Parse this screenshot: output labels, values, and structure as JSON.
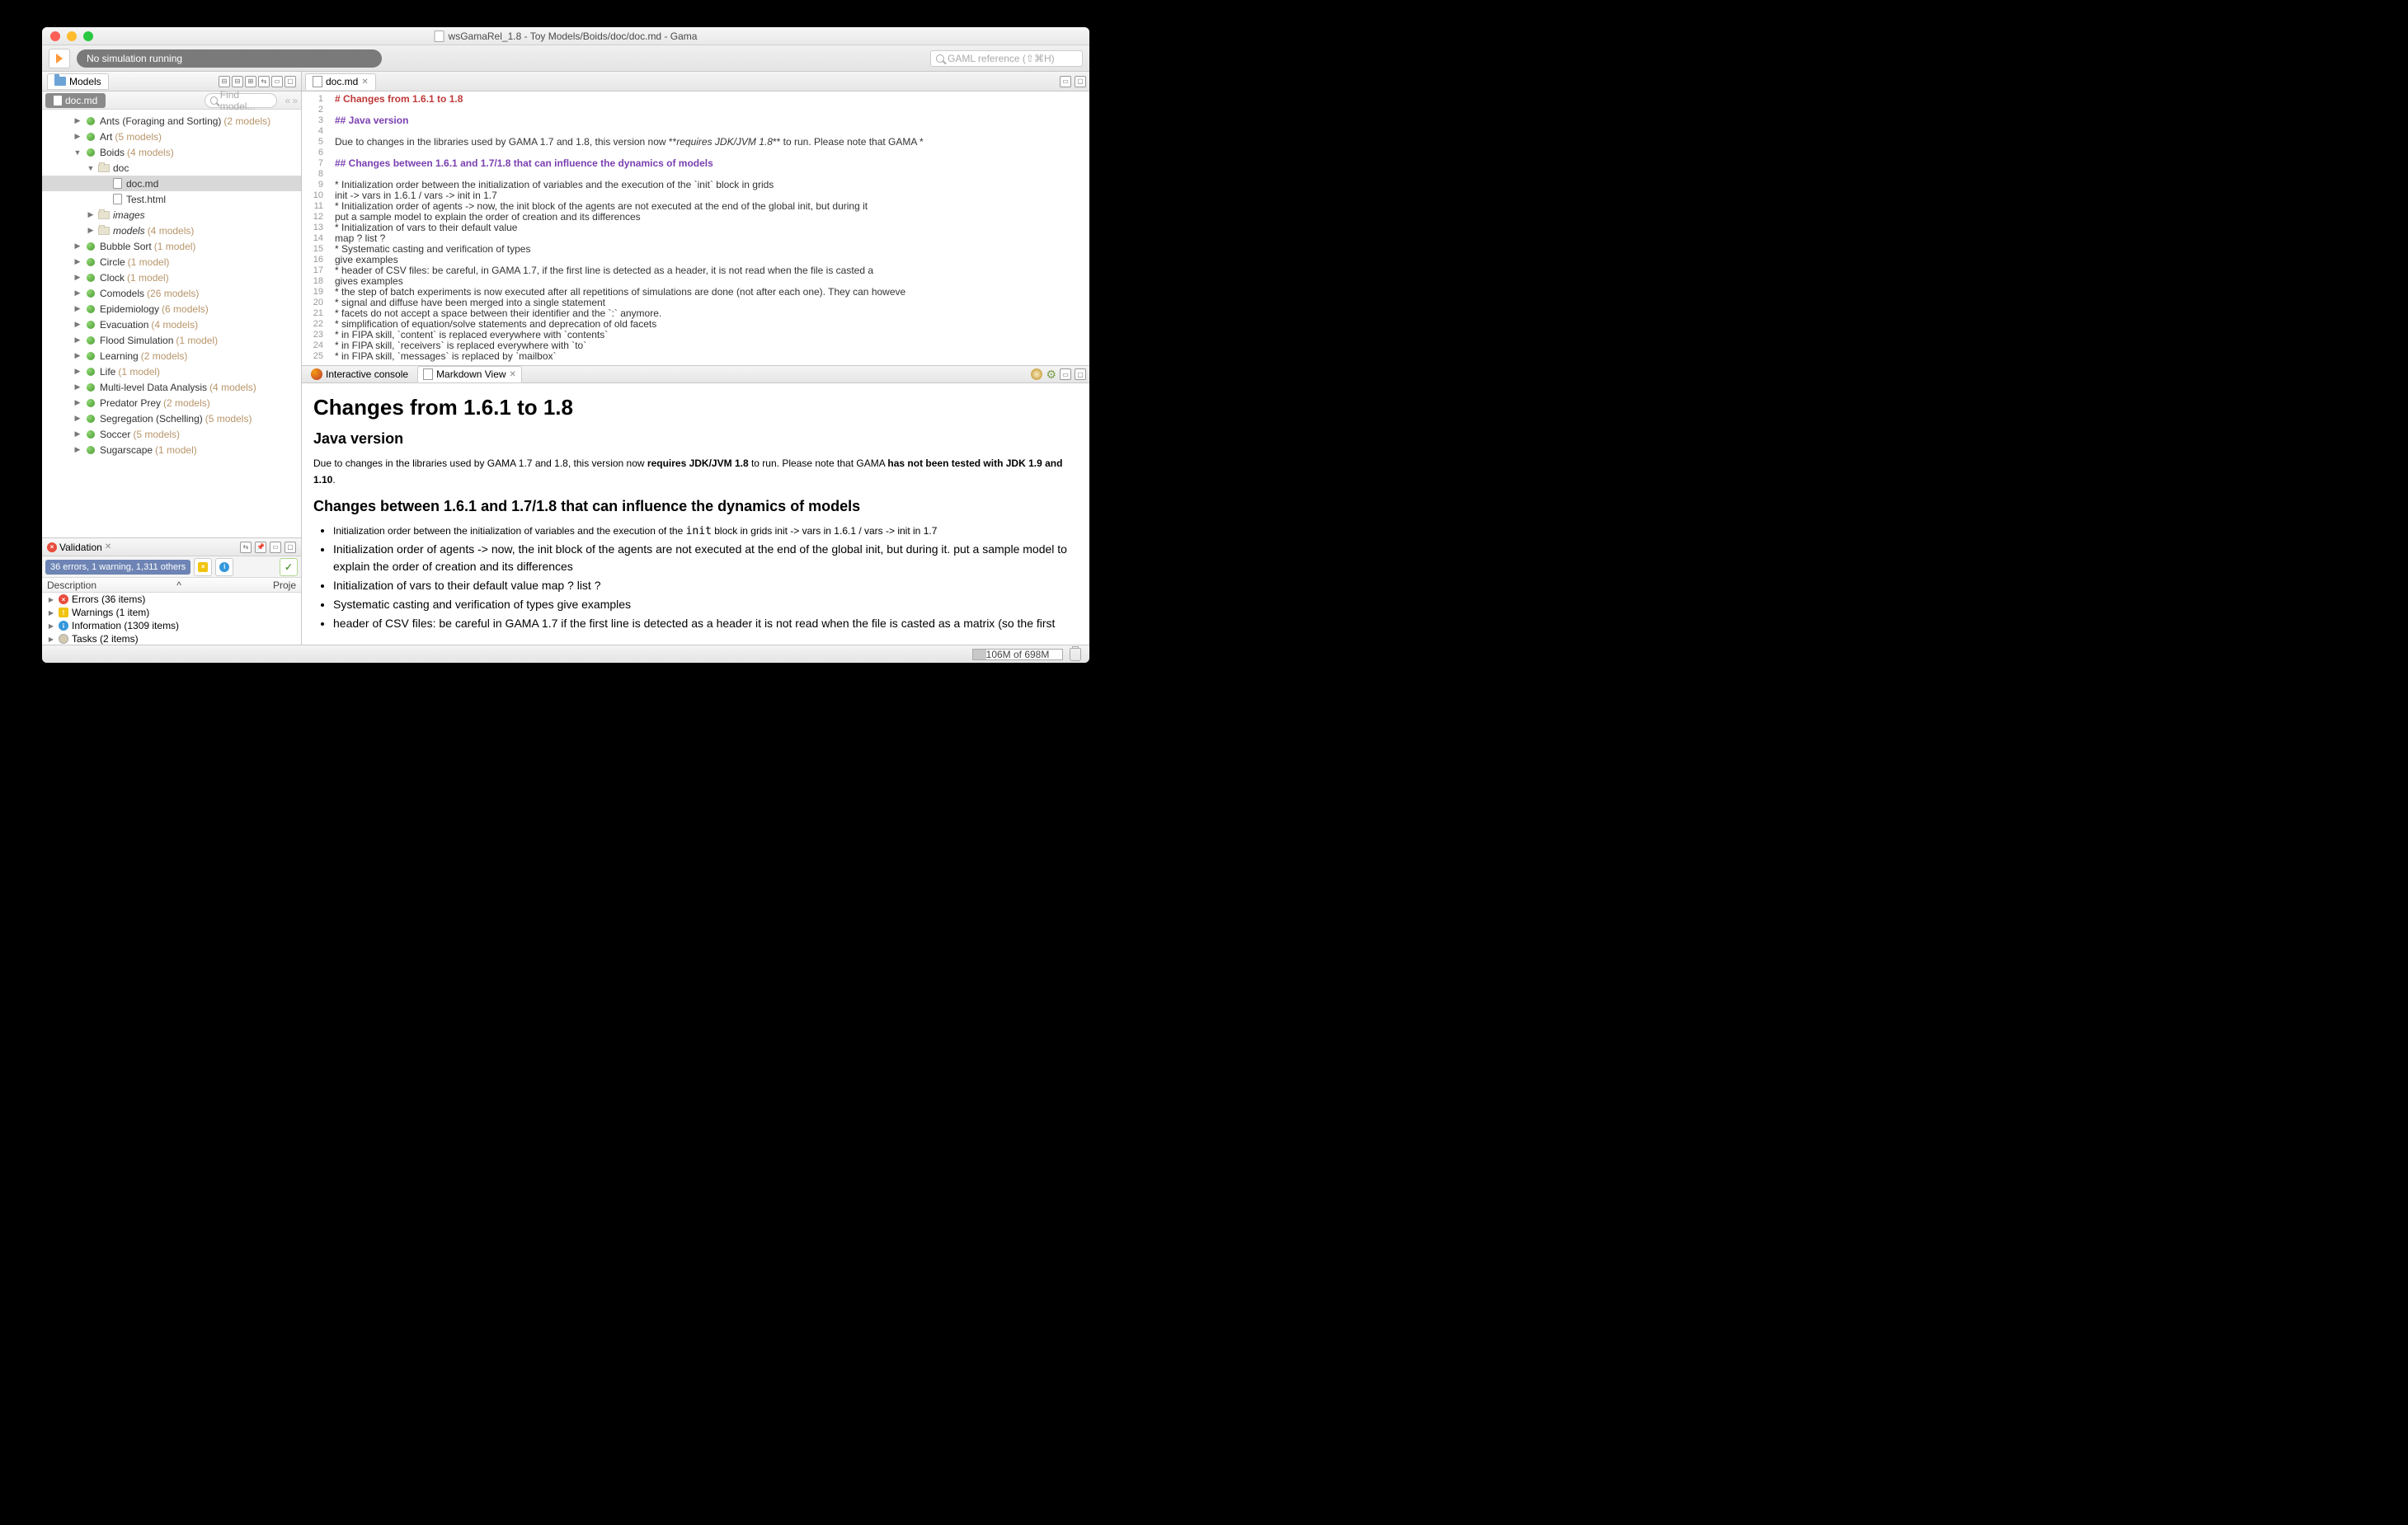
{
  "window": {
    "title": "wsGamaRel_1.8 - Toy Models/Boids/doc/doc.md - Gama"
  },
  "toolbar": {
    "sim_status": "No simulation running",
    "search_placeholder": "GAML reference (⇧⌘H)"
  },
  "models_pane": {
    "tab": "Models",
    "crumb": "doc.md",
    "find_placeholder": "Find model...",
    "tree": [
      {
        "d": 2,
        "a": "▶",
        "i": "sphere",
        "t": "Ants (Foraging and Sorting)",
        "c": "(2 models)"
      },
      {
        "d": 2,
        "a": "▶",
        "i": "sphere",
        "t": "Art",
        "c": "(5 models)"
      },
      {
        "d": 2,
        "a": "▼",
        "i": "sphere",
        "t": "Boids",
        "c": "(4 models)"
      },
      {
        "d": 3,
        "a": "▼",
        "i": "fld",
        "t": "doc",
        "c": ""
      },
      {
        "d": 4,
        "a": "",
        "i": "file",
        "t": "doc.md",
        "c": "",
        "sel": true
      },
      {
        "d": 4,
        "a": "",
        "i": "file",
        "t": "Test.html",
        "c": ""
      },
      {
        "d": 3,
        "a": "▶",
        "i": "fld",
        "t": "images",
        "c": "",
        "it": true
      },
      {
        "d": 3,
        "a": "▶",
        "i": "fld",
        "t": "models",
        "c": "(4 models)",
        "it": true
      },
      {
        "d": 2,
        "a": "▶",
        "i": "sphere",
        "t": "Bubble Sort",
        "c": "(1 model)"
      },
      {
        "d": 2,
        "a": "▶",
        "i": "sphere",
        "t": "Circle",
        "c": "(1 model)"
      },
      {
        "d": 2,
        "a": "▶",
        "i": "sphere",
        "t": "Clock",
        "c": "(1 model)"
      },
      {
        "d": 2,
        "a": "▶",
        "i": "sphere",
        "t": "Comodels",
        "c": "(26 models)"
      },
      {
        "d": 2,
        "a": "▶",
        "i": "sphere",
        "t": "Epidemiology",
        "c": "(6 models)"
      },
      {
        "d": 2,
        "a": "▶",
        "i": "sphere",
        "t": "Evacuation",
        "c": "(4 models)"
      },
      {
        "d": 2,
        "a": "▶",
        "i": "sphere",
        "t": "Flood Simulation",
        "c": "(1 model)"
      },
      {
        "d": 2,
        "a": "▶",
        "i": "sphere",
        "t": "Learning",
        "c": "(2 models)"
      },
      {
        "d": 2,
        "a": "▶",
        "i": "sphere",
        "t": "Life",
        "c": "(1 model)"
      },
      {
        "d": 2,
        "a": "▶",
        "i": "sphere",
        "t": "Multi-level Data Analysis",
        "c": "(4 models)"
      },
      {
        "d": 2,
        "a": "▶",
        "i": "sphere",
        "t": "Predator Prey",
        "c": "(2 models)"
      },
      {
        "d": 2,
        "a": "▶",
        "i": "sphere",
        "t": "Segregation (Schelling)",
        "c": "(5 models)"
      },
      {
        "d": 2,
        "a": "▶",
        "i": "sphere",
        "t": "Soccer",
        "c": "(5 models)"
      },
      {
        "d": 2,
        "a": "▶",
        "i": "sphere",
        "t": "Sugarscape",
        "c": "(1 model)"
      }
    ]
  },
  "validation": {
    "tab": "Validation",
    "summary": "36 errors, 1 warning, 1,311 others",
    "col_desc": "Description",
    "col_proj": "Proje",
    "rows": [
      {
        "ic": "err",
        "t": "Errors (36 items)"
      },
      {
        "ic": "warn",
        "t": "Warnings (1 item)"
      },
      {
        "ic": "info",
        "t": "Information (1309 items)"
      },
      {
        "ic": "task",
        "t": "Tasks (2 items)"
      }
    ]
  },
  "editor": {
    "tab": "doc.md",
    "lines": [
      {
        "n": 1,
        "cls": "h1",
        "t": "# Changes from 1.6.1 to 1.8"
      },
      {
        "n": 2,
        "cls": "",
        "t": ""
      },
      {
        "n": 3,
        "cls": "h2",
        "t": "## Java version"
      },
      {
        "n": 4,
        "cls": "",
        "t": ""
      },
      {
        "n": 5,
        "cls": "",
        "t": "Due to changes in the libraries used by GAMA 1.7 and 1.8, this version now **<i>requires JDK/JVM 1.8</i>** to run. Please note that GAMA *"
      },
      {
        "n": 6,
        "cls": "",
        "t": ""
      },
      {
        "n": 7,
        "cls": "h2",
        "t": "## Changes between 1.6.1 and 1.7/1.8 that can influence the dynamics of models"
      },
      {
        "n": 8,
        "cls": "",
        "t": ""
      },
      {
        "n": 9,
        "cls": "",
        "t": "* Initialization order between the initialization of variables and the execution of the `init` block in grids"
      },
      {
        "n": 10,
        "cls": "",
        "t": "init -> vars in 1.6.1 / vars -> init in 1.7"
      },
      {
        "n": 11,
        "cls": "",
        "t": "* Initialization order of agents -> now, the init block of the agents are not executed at the end of the global init, but during it"
      },
      {
        "n": 12,
        "cls": "",
        "t": "put a sample model to explain the order of creation and its differences"
      },
      {
        "n": 13,
        "cls": "",
        "t": "* Initialization of vars to their default value"
      },
      {
        "n": 14,
        "cls": "",
        "t": "map ? list ?"
      },
      {
        "n": 15,
        "cls": "",
        "t": "* Systematic casting and verification of types"
      },
      {
        "n": 16,
        "cls": "",
        "t": "give examples"
      },
      {
        "n": 17,
        "cls": "",
        "t": "* header of CSV files: be careful, in GAMA 1.7, if the first line is detected as a header, it is not read when the file is casted a"
      },
      {
        "n": 18,
        "cls": "",
        "t": "gives examples"
      },
      {
        "n": 19,
        "cls": "",
        "t": "* the step of batch experiments is now executed after all repetitions of simulations are done (not after each one). They can howeve"
      },
      {
        "n": 20,
        "cls": "",
        "t": "* signal and diffuse have been merged into a single statement"
      },
      {
        "n": 21,
        "cls": "",
        "t": "* facets do not accept a space between their identifier and the `:` anymore."
      },
      {
        "n": 22,
        "cls": "",
        "t": "* simplification of equation/solve statements and deprecation of old facets"
      },
      {
        "n": 23,
        "cls": "",
        "t": "* in FIPA skill, `content` is replaced everywhere with `contents`"
      },
      {
        "n": 24,
        "cls": "",
        "t": "* in FIPA skill, `receivers` is replaced everywhere with `to`"
      },
      {
        "n": 25,
        "cls": "",
        "t": "* in FIPA skill, `messages` is replaced by `mailbox`"
      }
    ]
  },
  "bottom_tabs": {
    "console": "Interactive console",
    "markdown": "Markdown View"
  },
  "markdown": {
    "h1": "Changes from 1.6.1 to 1.8",
    "h2a": "Java version",
    "p1_a": "Due to changes in the libraries used by GAMA 1.7 and 1.8, this version now ",
    "p1_b": "requires JDK/JVM 1.8",
    "p1_c": " to run. Please note that GAMA ",
    "p1_d": "has not been tested with JDK 1.9 and 1.10",
    "p1_e": ".",
    "h2b": "Changes between 1.6.1 and 1.7/1.8 that can influence the dynamics of models",
    "li1_a": "Initialization order between the initialization of variables and the execution of the ",
    "li1_code": "init",
    "li1_b": " block in grids init -> vars in 1.6.1 / vars -> init in 1.7",
    "li2": "Initialization order of agents -> now, the init block of the agents are not executed at the end of the global init, but during it. put a sample model to explain the order of creation and its differences",
    "li3": "Initialization of vars to their default value map ? list ?",
    "li4": "Systematic casting and verification of types give examples",
    "li5": "header of CSV files: be careful  in GAMA 1.7  if the first line is detected as a header  it is not read when the file is casted as a matrix (so the first"
  },
  "status": {
    "mem": "106M of 698M"
  }
}
